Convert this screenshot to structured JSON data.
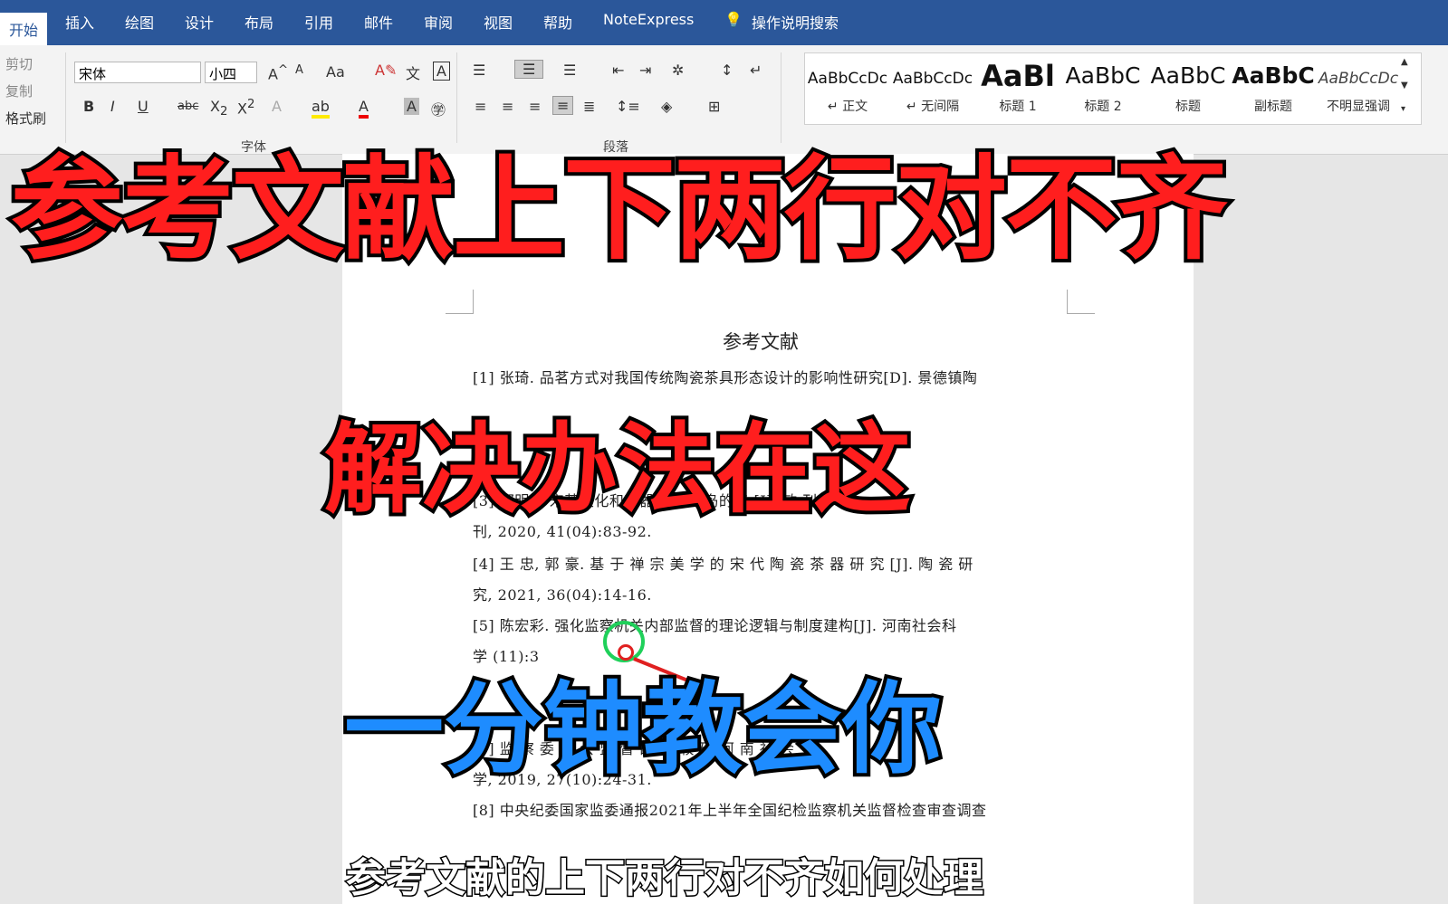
{
  "tabs": [
    "开始",
    "插入",
    "绘图",
    "设计",
    "布局",
    "引用",
    "邮件",
    "审阅",
    "视图",
    "帮助",
    "NoteExpress",
    "操作说明搜索"
  ],
  "clipboard": {
    "cut": "剪切",
    "copy": "复制",
    "format_painter": "格式刷"
  },
  "font": {
    "name": "宋体",
    "size": "小四",
    "case_btn": "Aa",
    "group_label": "字体"
  },
  "paragraph": {
    "group_label": "段落"
  },
  "styles": [
    {
      "sample": "AaBbCcDc",
      "name": "↵ 正文"
    },
    {
      "sample": "AaBbCcDc",
      "name": "↵ 无间隔"
    },
    {
      "sample": "AaBl",
      "name": "标题 1"
    },
    {
      "sample": "AaBbC",
      "name": "标题 2"
    },
    {
      "sample": "AaBbC",
      "name": "标题"
    },
    {
      "sample": "AaBbC",
      "name": "副标题"
    },
    {
      "sample": "AaBbCcDc",
      "name": "不明显强调"
    }
  ],
  "document": {
    "heading": "参考文献",
    "lines": [
      "[1] 张琦. 品茗方式对我国传统陶瓷茶具形态设计的影响性研究[D]. 景德镇陶",
      "[3] 郑明杉 宋茶文化和茶器 朝鲜半岛的传 [J]. 敏 刊",
      "刊, 2020, 41(04):83-92.",
      "[4] 王 忠, 郭 豪. 基 于 禅 宗 美 学 的 宋 代 陶 瓷 茶 器 研 究 [J]. 陶 瓷 研",
      "究, 2021, 36(04):14-16.",
      "[5] 陈宏彩. 强化监察机关内部监督的理论逻辑与制度建构[J]. 河南社会科",
      "学 (11):3",
      "[7] 监 察 委 员 会 监 督 的 比 较 研 河 南 社 会",
      "学, 2019, 27(10):24-31.",
      "[8] 中央纪委国家监委通报2021年上半年全国纪检监察机关监督检查审查调查"
    ]
  },
  "overlay": {
    "title": "参考文献上下两行对不齐",
    "middle": "解决办法在这",
    "bottom": "一分钟教会你",
    "subtitle": "参考文献的上下两行对不齐如何处理"
  }
}
